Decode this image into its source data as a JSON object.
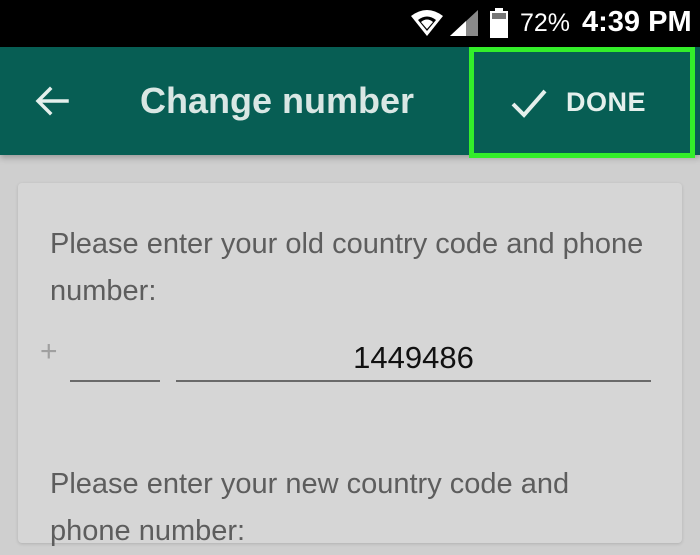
{
  "status_bar": {
    "battery_percent": "72%",
    "time": "4:39 PM",
    "icons": [
      "wifi-icon",
      "signal-icon",
      "battery-icon"
    ]
  },
  "app_bar": {
    "title": "Change number",
    "back_icon": "arrow-left-icon",
    "done_label": "DONE",
    "done_icon": "check-icon",
    "background": "#075e54",
    "highlight_border": "#33ee2a"
  },
  "form": {
    "old_prompt": "Please enter your old country code and phone number:",
    "plus_sign": "+",
    "old_country_code": "",
    "old_phone_number": "1449486",
    "new_prompt": "Please enter your new country code and phone number:"
  }
}
